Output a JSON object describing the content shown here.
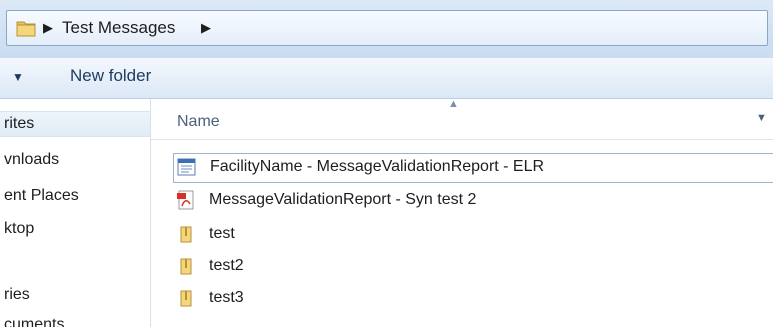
{
  "address": {
    "crumbs": [
      "Test Messages"
    ]
  },
  "toolbar": {
    "new_folder_label": "New folder"
  },
  "nav": {
    "items": [
      {
        "label": "rites",
        "selected": true
      },
      {
        "label": "vnloads"
      },
      {
        "label": "ent Places"
      },
      {
        "label": "ktop"
      },
      {
        "label": "ries"
      },
      {
        "label": "cuments"
      }
    ]
  },
  "columns": {
    "name": "Name"
  },
  "files": [
    {
      "name": "FacilityName - MessageValidationReport - ELR",
      "icon": "document-icon",
      "selected": true
    },
    {
      "name": "MessageValidationReport - Syn test 2",
      "icon": "pdf-icon"
    },
    {
      "name": "test",
      "icon": "folder-icon"
    },
    {
      "name": "test2",
      "icon": "folder-icon"
    },
    {
      "name": "test3",
      "icon": "folder-icon"
    }
  ],
  "colors": {
    "folder": "#e8c35a",
    "pdf": "#d9302c",
    "accent": "#1e3a5f"
  }
}
